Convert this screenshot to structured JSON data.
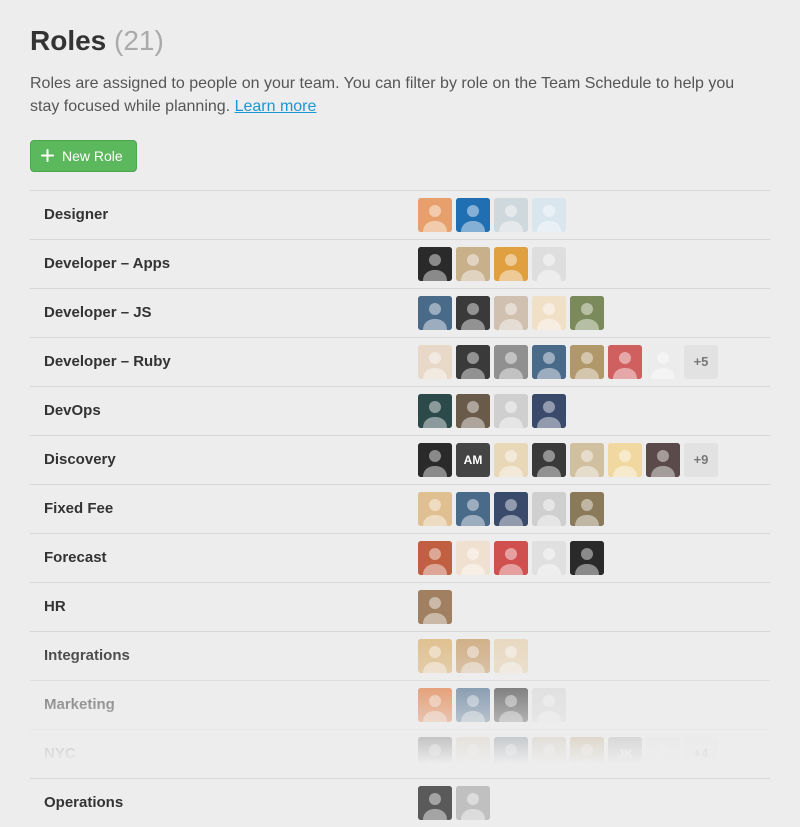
{
  "header": {
    "title": "Roles",
    "count": "(21)",
    "description_prefix": "Roles are assigned to people on your team. You can filter by role on the Team Schedule to help you stay focused while planning. ",
    "learn_more_label": "Learn more"
  },
  "toolbar": {
    "new_role_label": "New Role"
  },
  "roles": [
    {
      "name": "Designer",
      "avatars": [
        {
          "bg": "#e7a06b"
        },
        {
          "bg": "#1f6fb2"
        },
        {
          "bg": "#cfd8dc"
        },
        {
          "bg": "#d9e6ee"
        }
      ],
      "more": null
    },
    {
      "name": "Developer – Apps",
      "avatars": [
        {
          "bg": "#2a2a2a"
        },
        {
          "bg": "#c7b08a"
        },
        {
          "bg": "#e0a040"
        },
        {
          "bg": "#dedede"
        }
      ],
      "more": null
    },
    {
      "name": "Developer – JS",
      "avatars": [
        {
          "bg": "#4a6a8a"
        },
        {
          "bg": "#3a3a3a"
        },
        {
          "bg": "#d0c0b0"
        },
        {
          "bg": "#f0e0c8"
        },
        {
          "bg": "#7a8a5a"
        }
      ],
      "more": null
    },
    {
      "name": "Developer – Ruby",
      "avatars": [
        {
          "bg": "#e8d8c8"
        },
        {
          "bg": "#3a3a3a"
        },
        {
          "bg": "#909090"
        },
        {
          "bg": "#4a6a8a"
        },
        {
          "bg": "#b0986a"
        },
        {
          "bg": "#d06060"
        },
        {
          "bg": "#ececec"
        }
      ],
      "more": "+5"
    },
    {
      "name": "DevOps",
      "avatars": [
        {
          "bg": "#2d4a4a"
        },
        {
          "bg": "#6a5a4a"
        },
        {
          "bg": "#cfcfcf"
        },
        {
          "bg": "#3a4a6a"
        }
      ],
      "more": null
    },
    {
      "name": "Discovery",
      "avatars": [
        {
          "bg": "#2a2a2a"
        },
        {
          "type": "initials",
          "txt": "AM"
        },
        {
          "bg": "#e8d8b8"
        },
        {
          "bg": "#3a3a3a"
        },
        {
          "bg": "#d0c0a0"
        },
        {
          "bg": "#f0d8a0"
        },
        {
          "bg": "#5a4a4a"
        }
      ],
      "more": "+9"
    },
    {
      "name": "Fixed Fee",
      "avatars": [
        {
          "bg": "#e0c090"
        },
        {
          "bg": "#4a6a8a"
        },
        {
          "bg": "#3a4a6a"
        },
        {
          "bg": "#cfcfcf"
        },
        {
          "bg": "#8a7a5a"
        }
      ],
      "more": null
    },
    {
      "name": "Forecast",
      "avatars": [
        {
          "bg": "#c06040"
        },
        {
          "bg": "#f0e0d0"
        },
        {
          "bg": "#d05050"
        },
        {
          "bg": "#e0e0e0"
        },
        {
          "bg": "#2a2a2a"
        }
      ],
      "more": null
    },
    {
      "name": "HR",
      "avatars": [
        {
          "bg": "#a08060"
        }
      ],
      "more": null
    },
    {
      "name": "Integrations",
      "avatars": [
        {
          "bg": "#e0c090"
        },
        {
          "bg": "#d0b088"
        },
        {
          "bg": "#e8d8c0"
        }
      ],
      "more": null
    },
    {
      "name": "Marketing",
      "avatars": [
        {
          "bg": "#e07030"
        },
        {
          "bg": "#4a6a8a"
        },
        {
          "bg": "#3a3a3a"
        },
        {
          "bg": "#d8d8d8"
        }
      ],
      "more": null
    },
    {
      "name": "NYC",
      "avatars": [
        {
          "bg": "#2a2a2a"
        },
        {
          "bg": "#c8b8a0"
        },
        {
          "bg": "#3a4a5a"
        },
        {
          "bg": "#b8a890"
        },
        {
          "bg": "#a88850"
        },
        {
          "type": "initials",
          "txt": "JK",
          "bg": "#8a8a8a"
        },
        {
          "bg": "#e0e0e0"
        }
      ],
      "more": "+4"
    },
    {
      "name": "Operations",
      "avatars": [
        {
          "bg": "#5a5a5a"
        },
        {
          "bg": "#c0c0c0"
        }
      ],
      "more": null
    }
  ]
}
